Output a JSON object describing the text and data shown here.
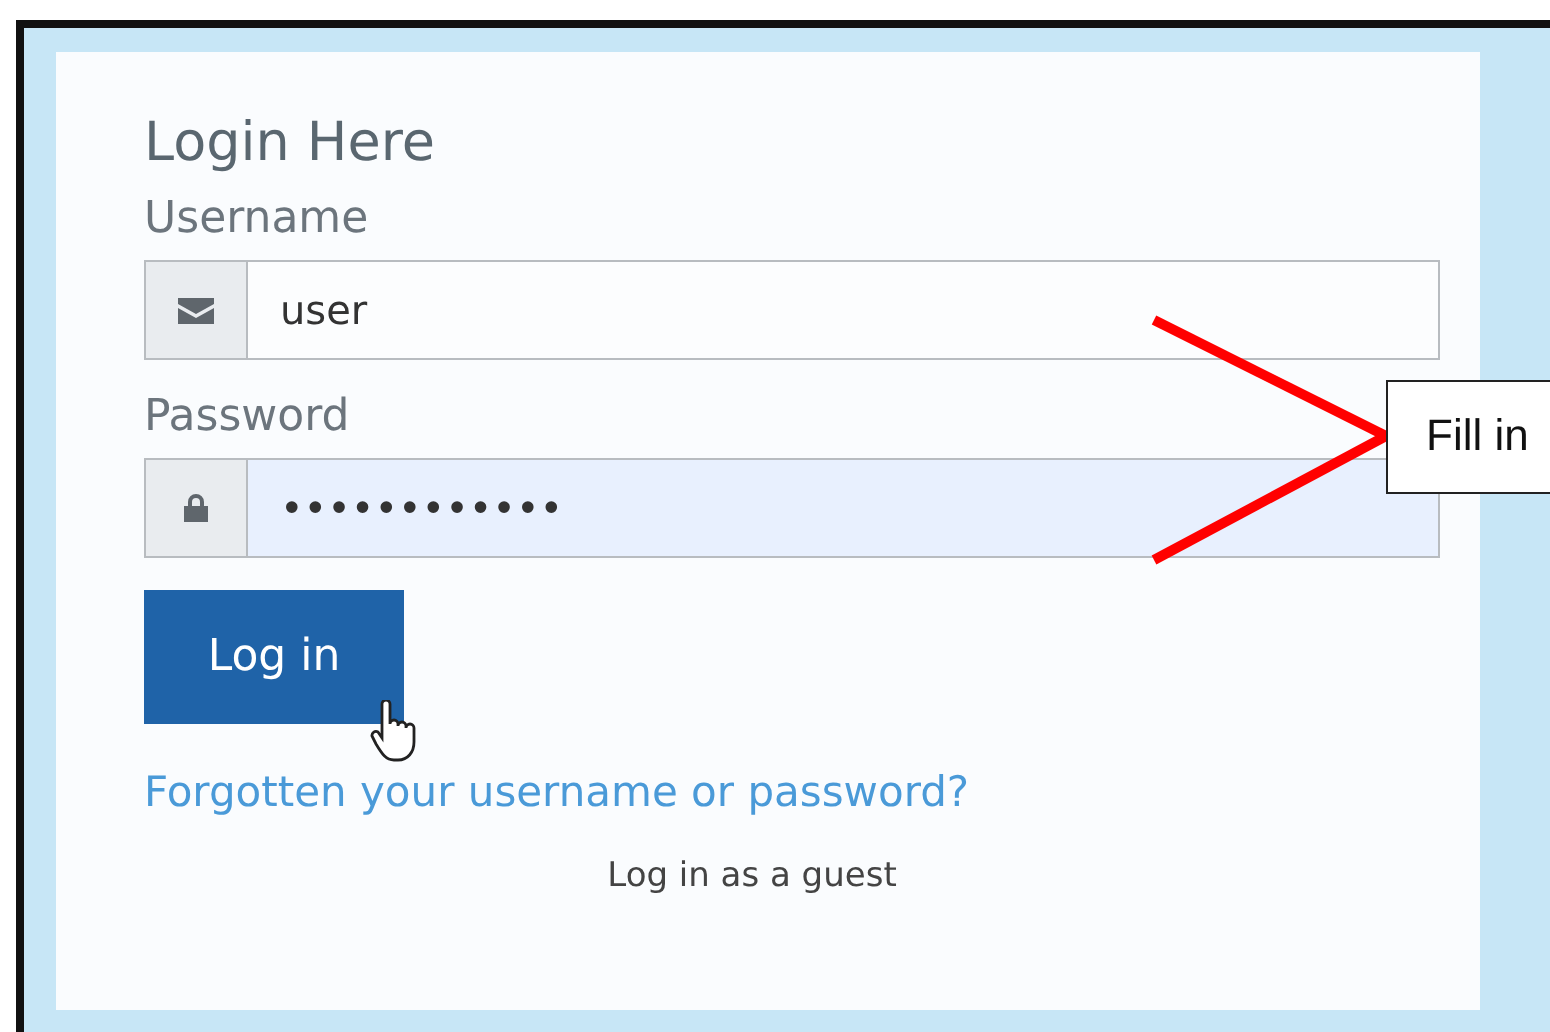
{
  "form": {
    "title": "Login Here",
    "fields": [
      {
        "label": "Username",
        "kind": "text",
        "value": "user",
        "highlighted": false
      },
      {
        "label": "Password",
        "kind": "password",
        "value": "••••••••••••",
        "highlighted": true
      }
    ],
    "submit": "Log in",
    "forgot_link": "Forgotten your username or password?",
    "guest_link": "Log in as a guest"
  },
  "annotation": {
    "text": "Fill in"
  }
}
